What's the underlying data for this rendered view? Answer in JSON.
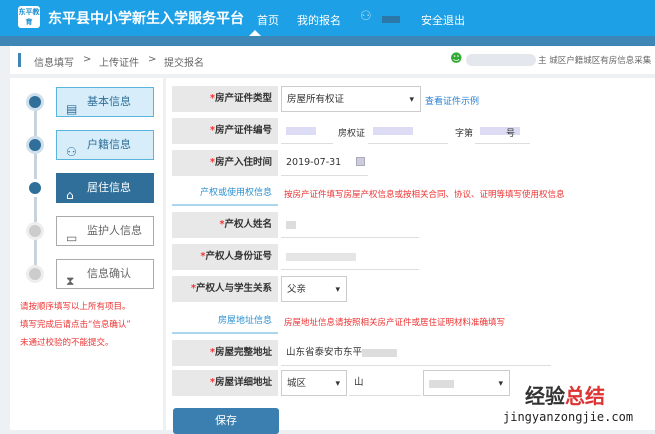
{
  "header": {
    "logo": "东平教育",
    "title": "东平县中小学新生入学服务平台",
    "nav": [
      "首页",
      "我的报名",
      "安全退出"
    ]
  },
  "breadcrumb": [
    "信息填写",
    ">",
    "上传证件",
    ">",
    "提交报名"
  ],
  "user_info": "主 城区户籍城区有房信息采集",
  "steps": [
    {
      "label": "基本信息",
      "state": "done"
    },
    {
      "label": "户籍信息",
      "state": "done"
    },
    {
      "label": "居住信息",
      "state": "active"
    },
    {
      "label": "监护人信息",
      "state": "pending"
    },
    {
      "label": "信息确认",
      "state": "pending"
    }
  ],
  "notes": [
    "请按顺序填写以上所有项目。",
    "填写完成后请点击“信息确认”",
    "未通过校验的不能提交。"
  ],
  "form": {
    "cert_type": {
      "label": "房产证件类型",
      "value": "房屋所有权证",
      "link": "查看证件示例"
    },
    "cert_no": {
      "label": "房产证件编号",
      "mid1": "房权证",
      "mid2": "字第",
      "end": "号"
    },
    "move_in": {
      "label": "房产入住时间",
      "value": "2019-07-31"
    },
    "sec1": {
      "title": "产权或使用权信息",
      "note": "按房产证件填写房屋产权信息或按相关合同、协议、证明等填写使用权信息"
    },
    "owner_name": {
      "label": "产权人姓名"
    },
    "owner_id": {
      "label": "产权人身份证号"
    },
    "relation": {
      "label": "产权人与学生关系",
      "value": "父亲"
    },
    "sec2": {
      "title": "房屋地址信息",
      "note": "房屋地址信息请按照相关房产证件或居住证明材料准确填写"
    },
    "full_addr": {
      "label": "房屋完整地址",
      "value": "山东省泰安市东平"
    },
    "detail_addr": {
      "label": "房屋详细地址",
      "district": "城区",
      "street": "山"
    },
    "save": "保存"
  },
  "watermark": {
    "cn1": "经验",
    "cn2": "总结",
    "url": "jingyanzongjie.com"
  }
}
